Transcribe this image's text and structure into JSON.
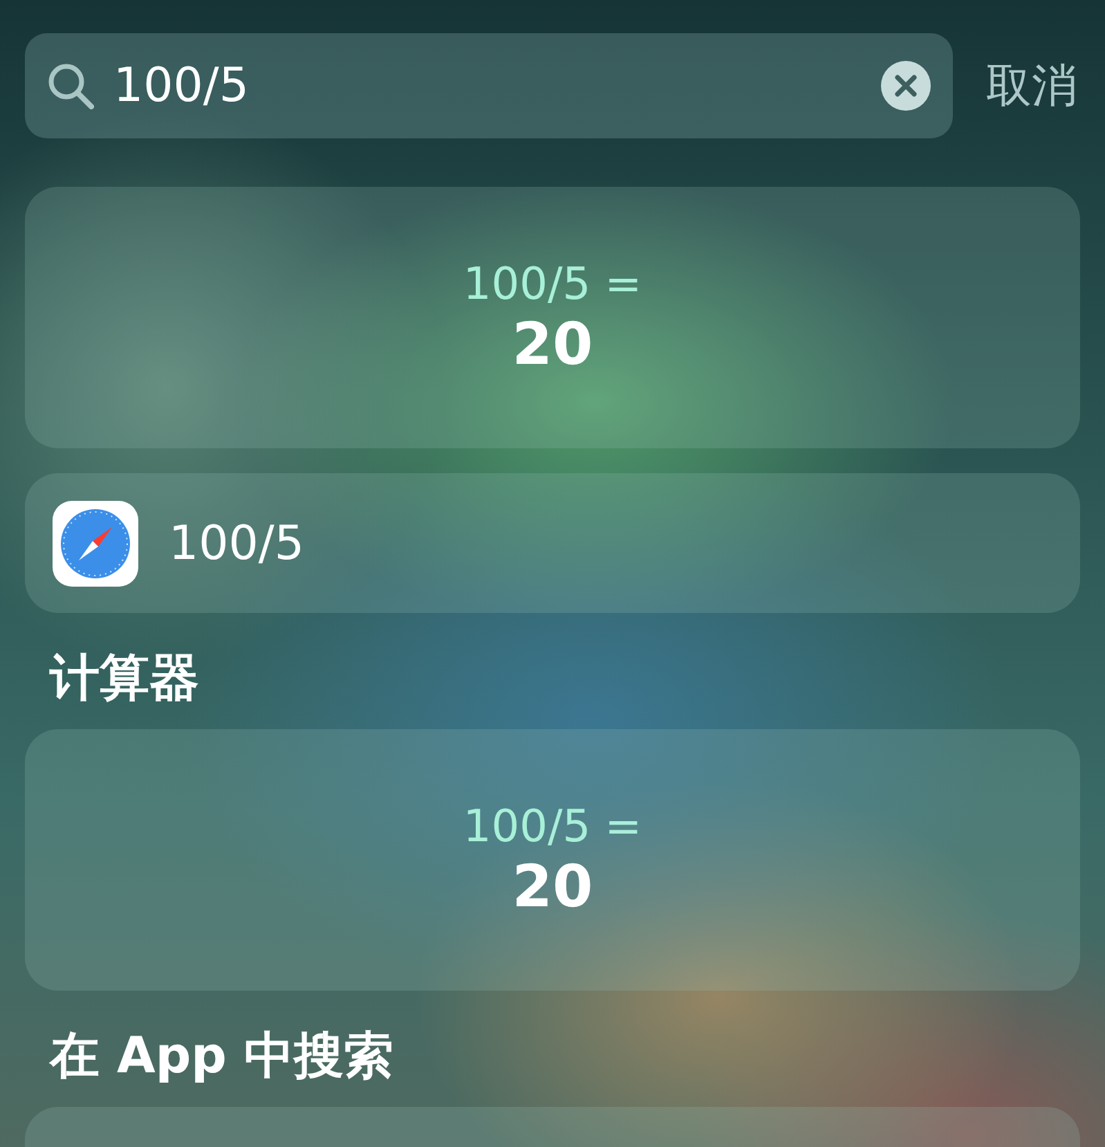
{
  "search": {
    "value": "100/5",
    "cancel": "取消"
  },
  "top_result": {
    "expression": "100/5 =",
    "result": "20"
  },
  "suggestion": {
    "text": "100/5"
  },
  "sections": [
    {
      "title": "计算器",
      "kind": "calculator",
      "expression": "100/5 =",
      "result": "20"
    },
    {
      "title": "在 App 中搜索",
      "kind": "list"
    }
  ]
}
